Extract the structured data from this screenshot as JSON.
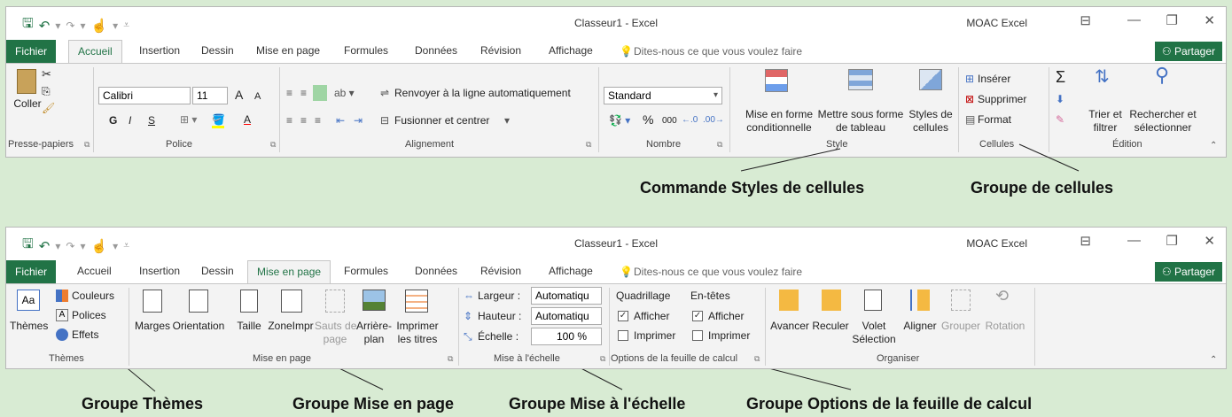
{
  "window": {
    "title": "Classeur1 - Excel",
    "user": "MOAC Excel",
    "share": "Partager",
    "tell_me": "Dites-nous ce que vous voulez faire"
  },
  "tabs": [
    "Fichier",
    "Accueil",
    "Insertion",
    "Dessin",
    "Mise en page",
    "Formules",
    "Données",
    "Révision",
    "Affichage"
  ],
  "ribbon1": {
    "active_tab": "Accueil",
    "clipboard": {
      "coller": "Coller",
      "group": "Presse-papiers"
    },
    "font": {
      "name": "Calibri",
      "size": "11",
      "group": "Police",
      "grow": "A",
      "shrink": "A",
      "bold": "G",
      "italic": "I",
      "underline": "S",
      "fill_letter": "A"
    },
    "alignment": {
      "wrap": "Renvoyer à la ligne automatiquement",
      "merge": "Fusionner et centrer",
      "group": "Alignement"
    },
    "number": {
      "format": "Standard",
      "percent": "%",
      "thousands": "000",
      "group": "Nombre"
    },
    "style": {
      "cond_1": "Mise en forme",
      "cond_2": "conditionnelle",
      "table_1": "Mettre sous forme",
      "table_2": "de tableau",
      "cell_1": "Styles de",
      "cell_2": "cellules",
      "group": "Style"
    },
    "cells": {
      "insert": "Insérer",
      "delete": "Supprimer",
      "format": "Format",
      "group": "Cellules"
    },
    "editing": {
      "sort_1": "Trier et",
      "sort_2": "filtrer",
      "find_1": "Rechercher et",
      "find_2": "sélectionner",
      "group": "Édition"
    }
  },
  "ribbon2": {
    "active_tab": "Mise en page",
    "themes": {
      "themes": "Thèmes",
      "colors": "Couleurs",
      "fonts": "Polices",
      "effects": "Effets",
      "group": "Thèmes"
    },
    "page_setup": {
      "marges": "Marges",
      "orientation": "Orientation",
      "taille": "Taille",
      "zone": "ZoneImpr",
      "sauts_1": "Sauts de",
      "sauts_2": "page",
      "arriere_1": "Arrière-",
      "arriere_2": "plan",
      "imprimer_1": "Imprimer",
      "imprimer_2": "les titres",
      "group": "Mise en page"
    },
    "scale": {
      "largeur": "Largeur :",
      "hauteur": "Hauteur :",
      "echelle": "Échelle :",
      "largeur_val": "Automatiqu",
      "hauteur_val": "Automatiqu",
      "echelle_val": "100 %",
      "group": "Mise à l'échelle"
    },
    "sheet_options": {
      "gridlines": "Quadrillage",
      "headings": "En-têtes",
      "view": "Afficher",
      "print": "Imprimer",
      "group": "Options de la feuille de calcul"
    },
    "arrange": {
      "avancer": "Avancer",
      "reculer": "Reculer",
      "volet_1": "Volet",
      "volet_2": "Sélection",
      "aligner": "Aligner",
      "grouper": "Grouper",
      "rotation": "Rotation",
      "group": "Organiser"
    }
  },
  "callouts": {
    "cell_styles": "Commande Styles de cellules",
    "cells_group": "Groupe de cellules",
    "themes_group": "Groupe Thèmes",
    "page_setup_group": "Groupe Mise en page",
    "scale_group": "Groupe Mise à l'échelle",
    "sheet_options_group": "Groupe Options de la feuille de calcul"
  },
  "colors": {
    "excel_green": "#217346",
    "background": "#d8ebd3"
  }
}
